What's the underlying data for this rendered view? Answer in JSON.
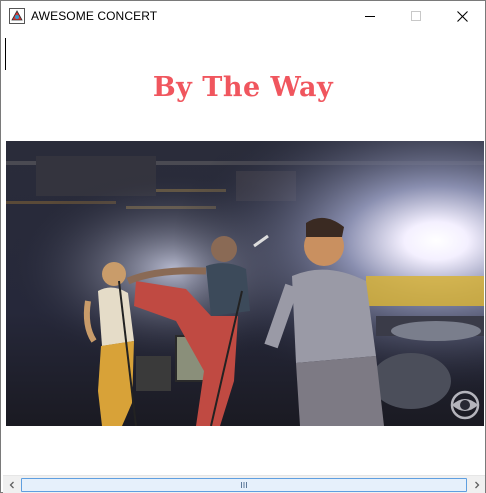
{
  "window": {
    "title": "AWESOME CONCERT",
    "controls": {
      "minimize": "minimize",
      "maximize": "maximize",
      "close": "close"
    }
  },
  "content": {
    "song_title": "By The Way",
    "song_title_color": "#f0565e",
    "video": {
      "watermark": "cbs-eye-logo"
    }
  },
  "scrollbar": {
    "orientation": "horizontal",
    "thumb_color": "#e6f0fb"
  }
}
